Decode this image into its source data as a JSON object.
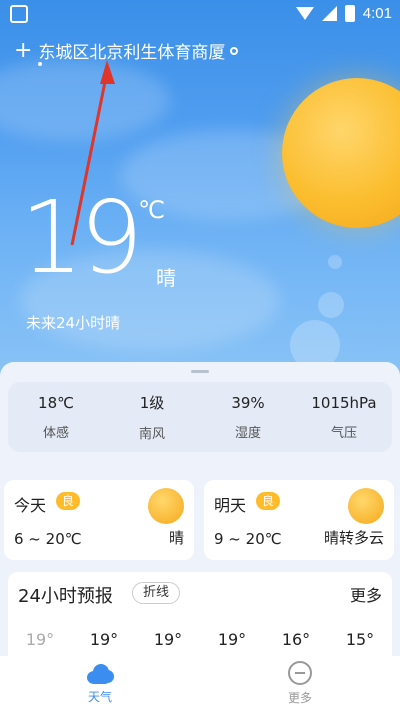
{
  "status_bar": {
    "time": "4:01"
  },
  "location": {
    "text": "东城区北京利生体育商厦"
  },
  "current": {
    "temperature": "19",
    "unit": "℃",
    "condition": "晴",
    "forecast_24h": "未来24小时晴"
  },
  "stats": [
    {
      "value": "18℃",
      "label": "体感"
    },
    {
      "value": "1级",
      "label": "南风"
    },
    {
      "value": "39%",
      "label": "湿度"
    },
    {
      "value": "1015hPa",
      "label": "气压"
    }
  ],
  "today": {
    "name": "今天",
    "badge": "良",
    "range": "6 ~ 20℃",
    "condition": "晴"
  },
  "tomorrow": {
    "name": "明天",
    "badge": "良",
    "range": "9 ~ 20℃",
    "condition": "晴转多云"
  },
  "hourly": {
    "title": "24小时预报",
    "chip": "折线",
    "more": "更多",
    "temps": [
      "19°",
      "19°",
      "19°",
      "19°",
      "16°",
      "15°"
    ]
  },
  "tabs": [
    {
      "label": "天气",
      "icon": "cloud-icon",
      "active": true
    },
    {
      "label": "更多",
      "icon": "more-circle-icon",
      "active": false
    }
  ],
  "colors": {
    "accent": "#3b8ef0",
    "badge": "#ffbb2a",
    "sky": "#3a8fe8",
    "sun": "#fbbd2e",
    "arrow": "#e0352b"
  }
}
